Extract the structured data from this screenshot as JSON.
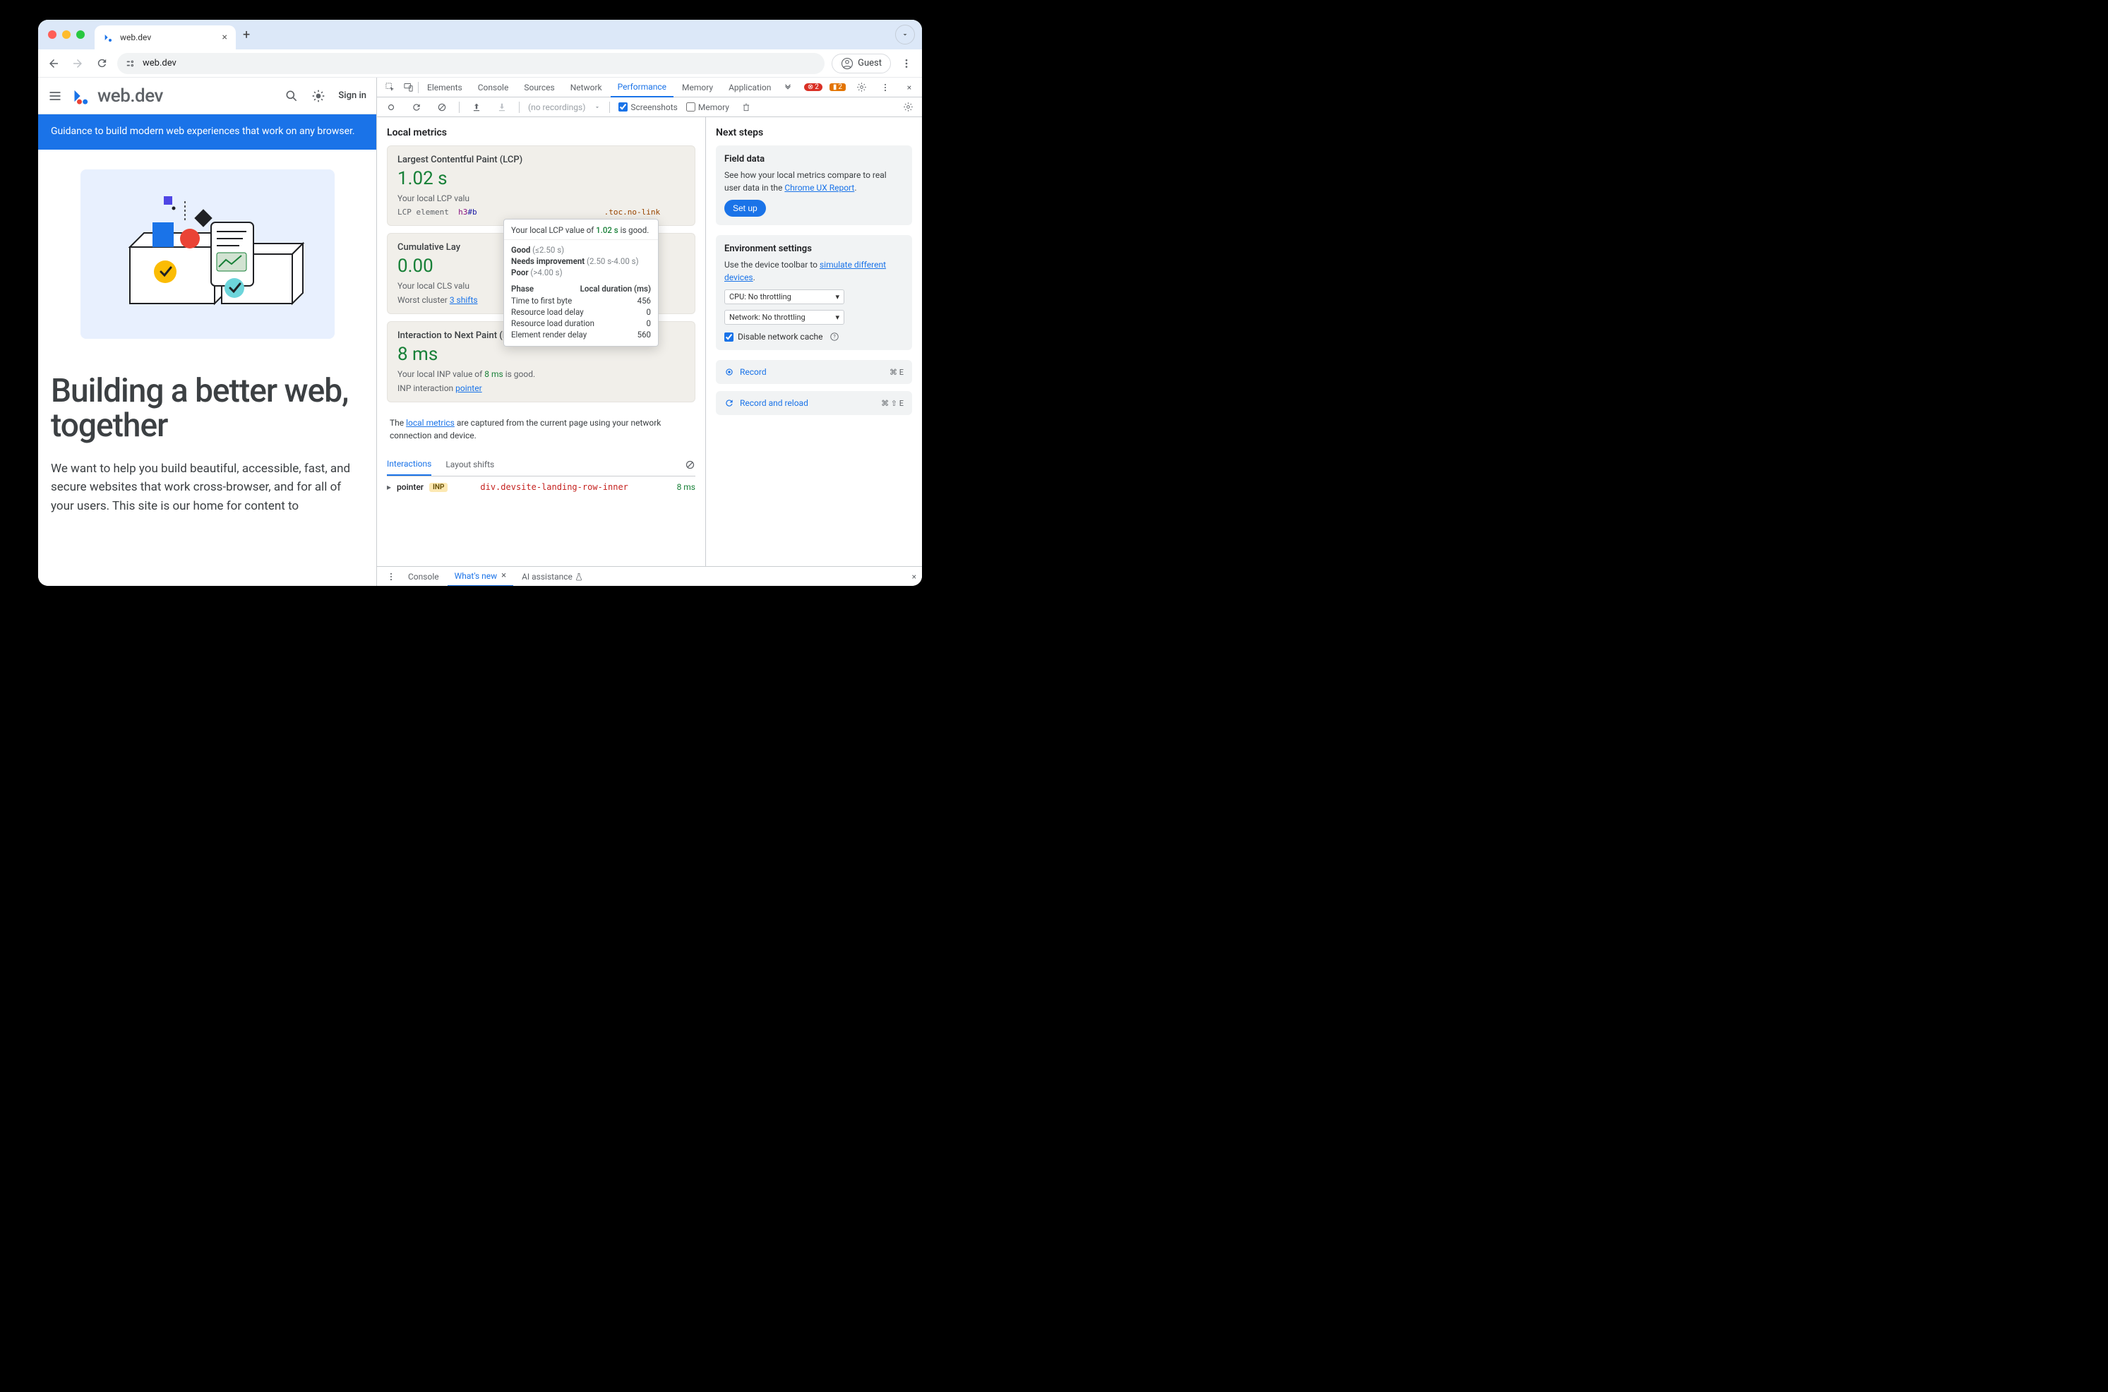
{
  "browser": {
    "tab_title": "web.dev",
    "url": "web.dev",
    "guest_label": "Guest"
  },
  "page": {
    "logo_text": "web.dev",
    "signin": "Sign in",
    "banner": "Guidance to build modern web experiences that work on any browser.",
    "hero_title": "Building a better web, together",
    "hero_sub": "We want to help you build beautiful, accessible, fast, and secure websites that work cross-browser, and for all of your users. This site is our home for content to"
  },
  "devtools": {
    "tabs": [
      "Elements",
      "Console",
      "Sources",
      "Network",
      "Performance",
      "Memory",
      "Application"
    ],
    "active_tab": "Performance",
    "errors": "2",
    "warnings": "2",
    "recordings_placeholder": "(no recordings)",
    "screenshots_label": "Screenshots",
    "memory_label": "Memory",
    "local_metrics_title": "Local metrics",
    "next_steps_title": "Next steps",
    "metrics": {
      "lcp": {
        "name": "Largest Contentful Paint (LCP)",
        "value": "1.02 s",
        "note_pre": "Your local LCP valu",
        "el_label": "LCP element",
        "el_tag": "h3",
        "el_id": "#b",
        "el_cls": ".toc.no-link"
      },
      "cls": {
        "name": "Cumulative Lay",
        "value": "0.00",
        "note_pre": "Your local CLS valu",
        "wc_label": "Worst cluster",
        "wc_link": "3 shifts"
      },
      "inp": {
        "name": "Interaction to Next Paint (INP)",
        "value": "8 ms",
        "note_pre": "Your local INP value of ",
        "note_val": "8 ms",
        "note_post": " is good.",
        "int_label": "INP interaction",
        "int_link": "pointer"
      }
    },
    "tooltip": {
      "header_pre": "Your local LCP value of ",
      "header_val": "1.02 s",
      "header_post": " is good.",
      "good_label": "Good",
      "good_range": "(≤2.50 s)",
      "ni_label": "Needs improvement",
      "ni_range": "(2.50 s-4.00 s)",
      "poor_label": "Poor",
      "poor_range": "(>4.00 s)",
      "phase_hdr": "Phase",
      "dur_hdr": "Local duration (ms)",
      "rows": [
        {
          "phase": "Time to first byte",
          "dur": "456"
        },
        {
          "phase": "Resource load delay",
          "dur": "0"
        },
        {
          "phase": "Resource load duration",
          "dur": "0"
        },
        {
          "phase": "Element render delay",
          "dur": "560"
        }
      ]
    },
    "footnote_pre": "The ",
    "footnote_link": "local metrics",
    "footnote_post": " are captured from the current page using your network connection and device.",
    "int_tabs": {
      "a": "Interactions",
      "b": "Layout shifts"
    },
    "int_row": {
      "kind": "pointer",
      "pill": "INP",
      "selector": "div.devsite-landing-row-inner",
      "time": "8 ms"
    },
    "side": {
      "field": {
        "title": "Field data",
        "text_pre": "See how your local metrics compare to real user data in the ",
        "link": "Chrome UX Report",
        "btn": "Set up"
      },
      "env": {
        "title": "Environment settings",
        "text_pre": "Use the device toolbar to ",
        "link": "simulate different devices",
        "cpu": "CPU: No throttling",
        "net": "Network: No throttling",
        "disable_cache": "Disable network cache"
      },
      "record": {
        "label": "Record",
        "kbd": "⌘ E"
      },
      "record_reload": {
        "label": "Record and reload",
        "kbd": "⌘ ⇧ E"
      }
    },
    "drawer": {
      "tabs": [
        "Console",
        "What's new",
        "AI assistance"
      ]
    }
  }
}
